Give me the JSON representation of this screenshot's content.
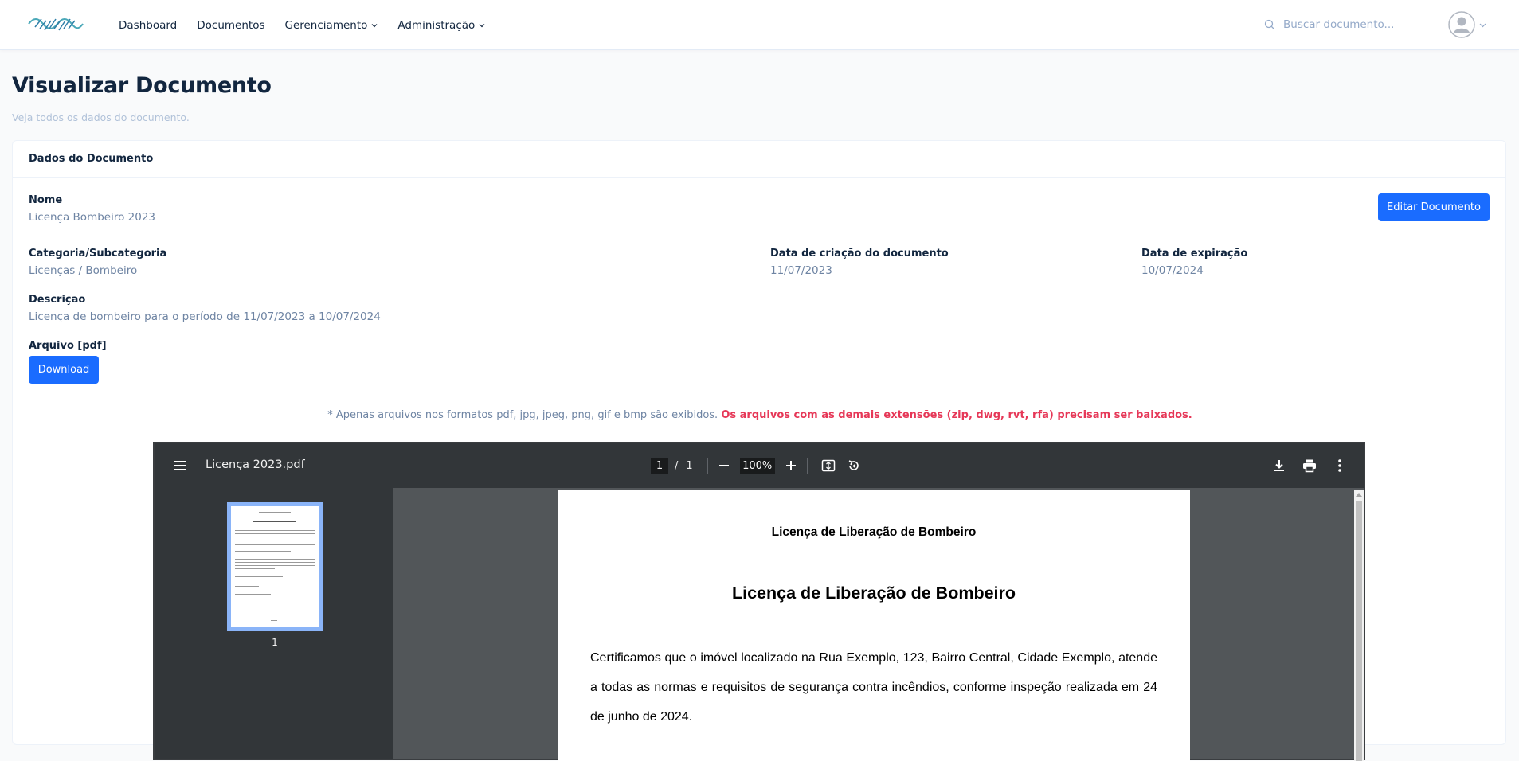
{
  "navbar": {
    "links": [
      "Dashboard",
      "Documentos",
      "Gerenciamento",
      "Administração"
    ],
    "search_placeholder": "Buscar documento..."
  },
  "page": {
    "title": "Visualizar Documento",
    "subtitle": "Veja todos os dados do documento."
  },
  "card": {
    "header": "Dados do Documento",
    "edit_button": "Editar Documento",
    "fields": {
      "nome_label": "Nome",
      "nome_value": "Licença Bombeiro 2023",
      "categoria_label": "Categoria/Subcategoria",
      "categoria_value": "Licenças / Bombeiro",
      "criacao_label": "Data de criação do documento",
      "criacao_value": "11/07/2023",
      "expiracao_label": "Data de expiração",
      "expiracao_value": "10/07/2024",
      "descricao_label": "Descrição",
      "descricao_value": "Licença de bombeiro para o período de 11/07/2023 a 10/07/2024",
      "arquivo_label": "Arquivo [pdf]"
    },
    "download_button": "Download",
    "note_normal": "* Apenas arquivos nos formatos pdf, jpg, jpeg, png, gif e bmp são exibidos.",
    "note_warning": "Os arquivos com as demais extensões (zip, dwg, rvt, rfa) precisam ser baixados."
  },
  "viewer": {
    "filename": "Licença 2023.pdf",
    "current_page": "1",
    "page_separator": "/",
    "total_pages": "1",
    "zoom": "100%",
    "thumbnail_label": "1",
    "pdf": {
      "header": "Licença de Liberação de Bombeiro",
      "title": "Licença de Liberação de Bombeiro",
      "body": "Certificamos que o imóvel localizado na Rua Exemplo, 123, Bairro Central, Cidade Exemplo, atende a todas as normas e requisitos de segurança contra incêndios, conforme inspeção realizada em 24 de junho de 2024."
    }
  },
  "colors": {
    "primary": "#1a6cff",
    "warning": "#e63757",
    "viewer_toolbar": "#323639",
    "viewer_bg": "#525659",
    "thumbnail_border": "#8ab4f8"
  },
  "icons": [
    "logo",
    "chevron-down-icon",
    "search-icon",
    "avatar-icon",
    "menu-icon",
    "minus-icon",
    "plus-icon",
    "fit-page-icon",
    "rotate-icon",
    "download-icon",
    "print-icon",
    "more-vert-icon"
  ]
}
